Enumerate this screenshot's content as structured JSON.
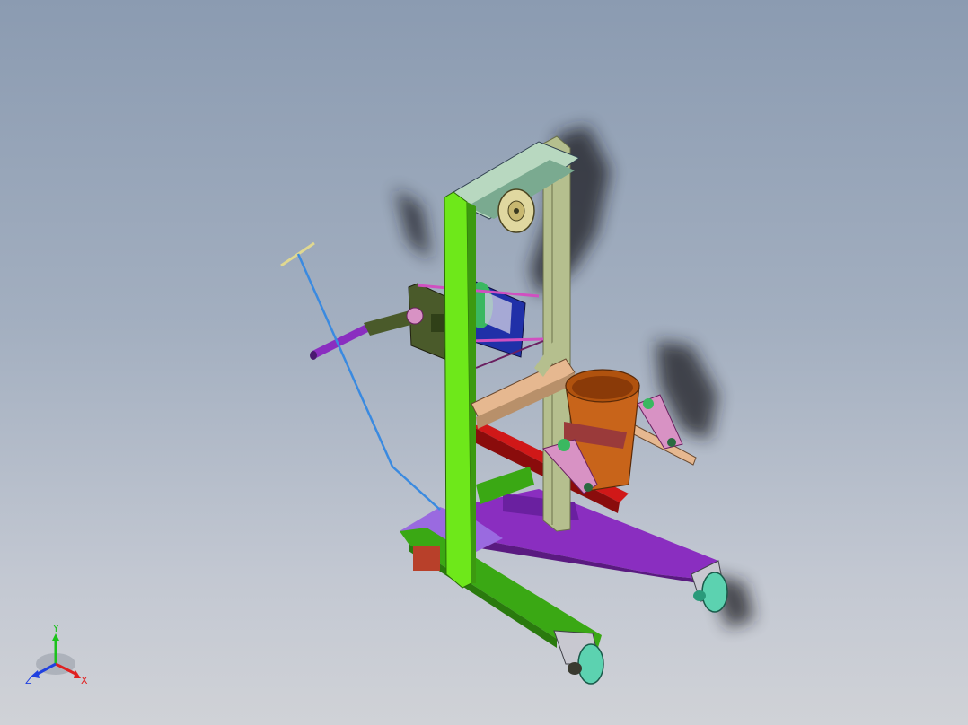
{
  "triad": {
    "x_label": "X",
    "y_label": "Y",
    "z_label": "Z",
    "colors": {
      "x": "#e02020",
      "y": "#1cc21c",
      "z": "#2040e0"
    }
  },
  "model": {
    "icon": "hand-winch-drum-lifter-assembly",
    "colors": {
      "mast": "#6ee81a",
      "mast_dark": "#3c9a10",
      "rear_mast": "#b5bf8e",
      "base_green": "#3aa814",
      "base_purple": "#8a2ec0",
      "red_beam": "#d01818",
      "drum": "#c8641a",
      "pink": "#d892c4",
      "wheel": "#5cd2b0",
      "winch_blue": "#2030a8",
      "handle": "#8a2ec0",
      "rod": "#3a8ae0",
      "wood": "#e6b890",
      "shadow": "#1a1a22"
    }
  }
}
